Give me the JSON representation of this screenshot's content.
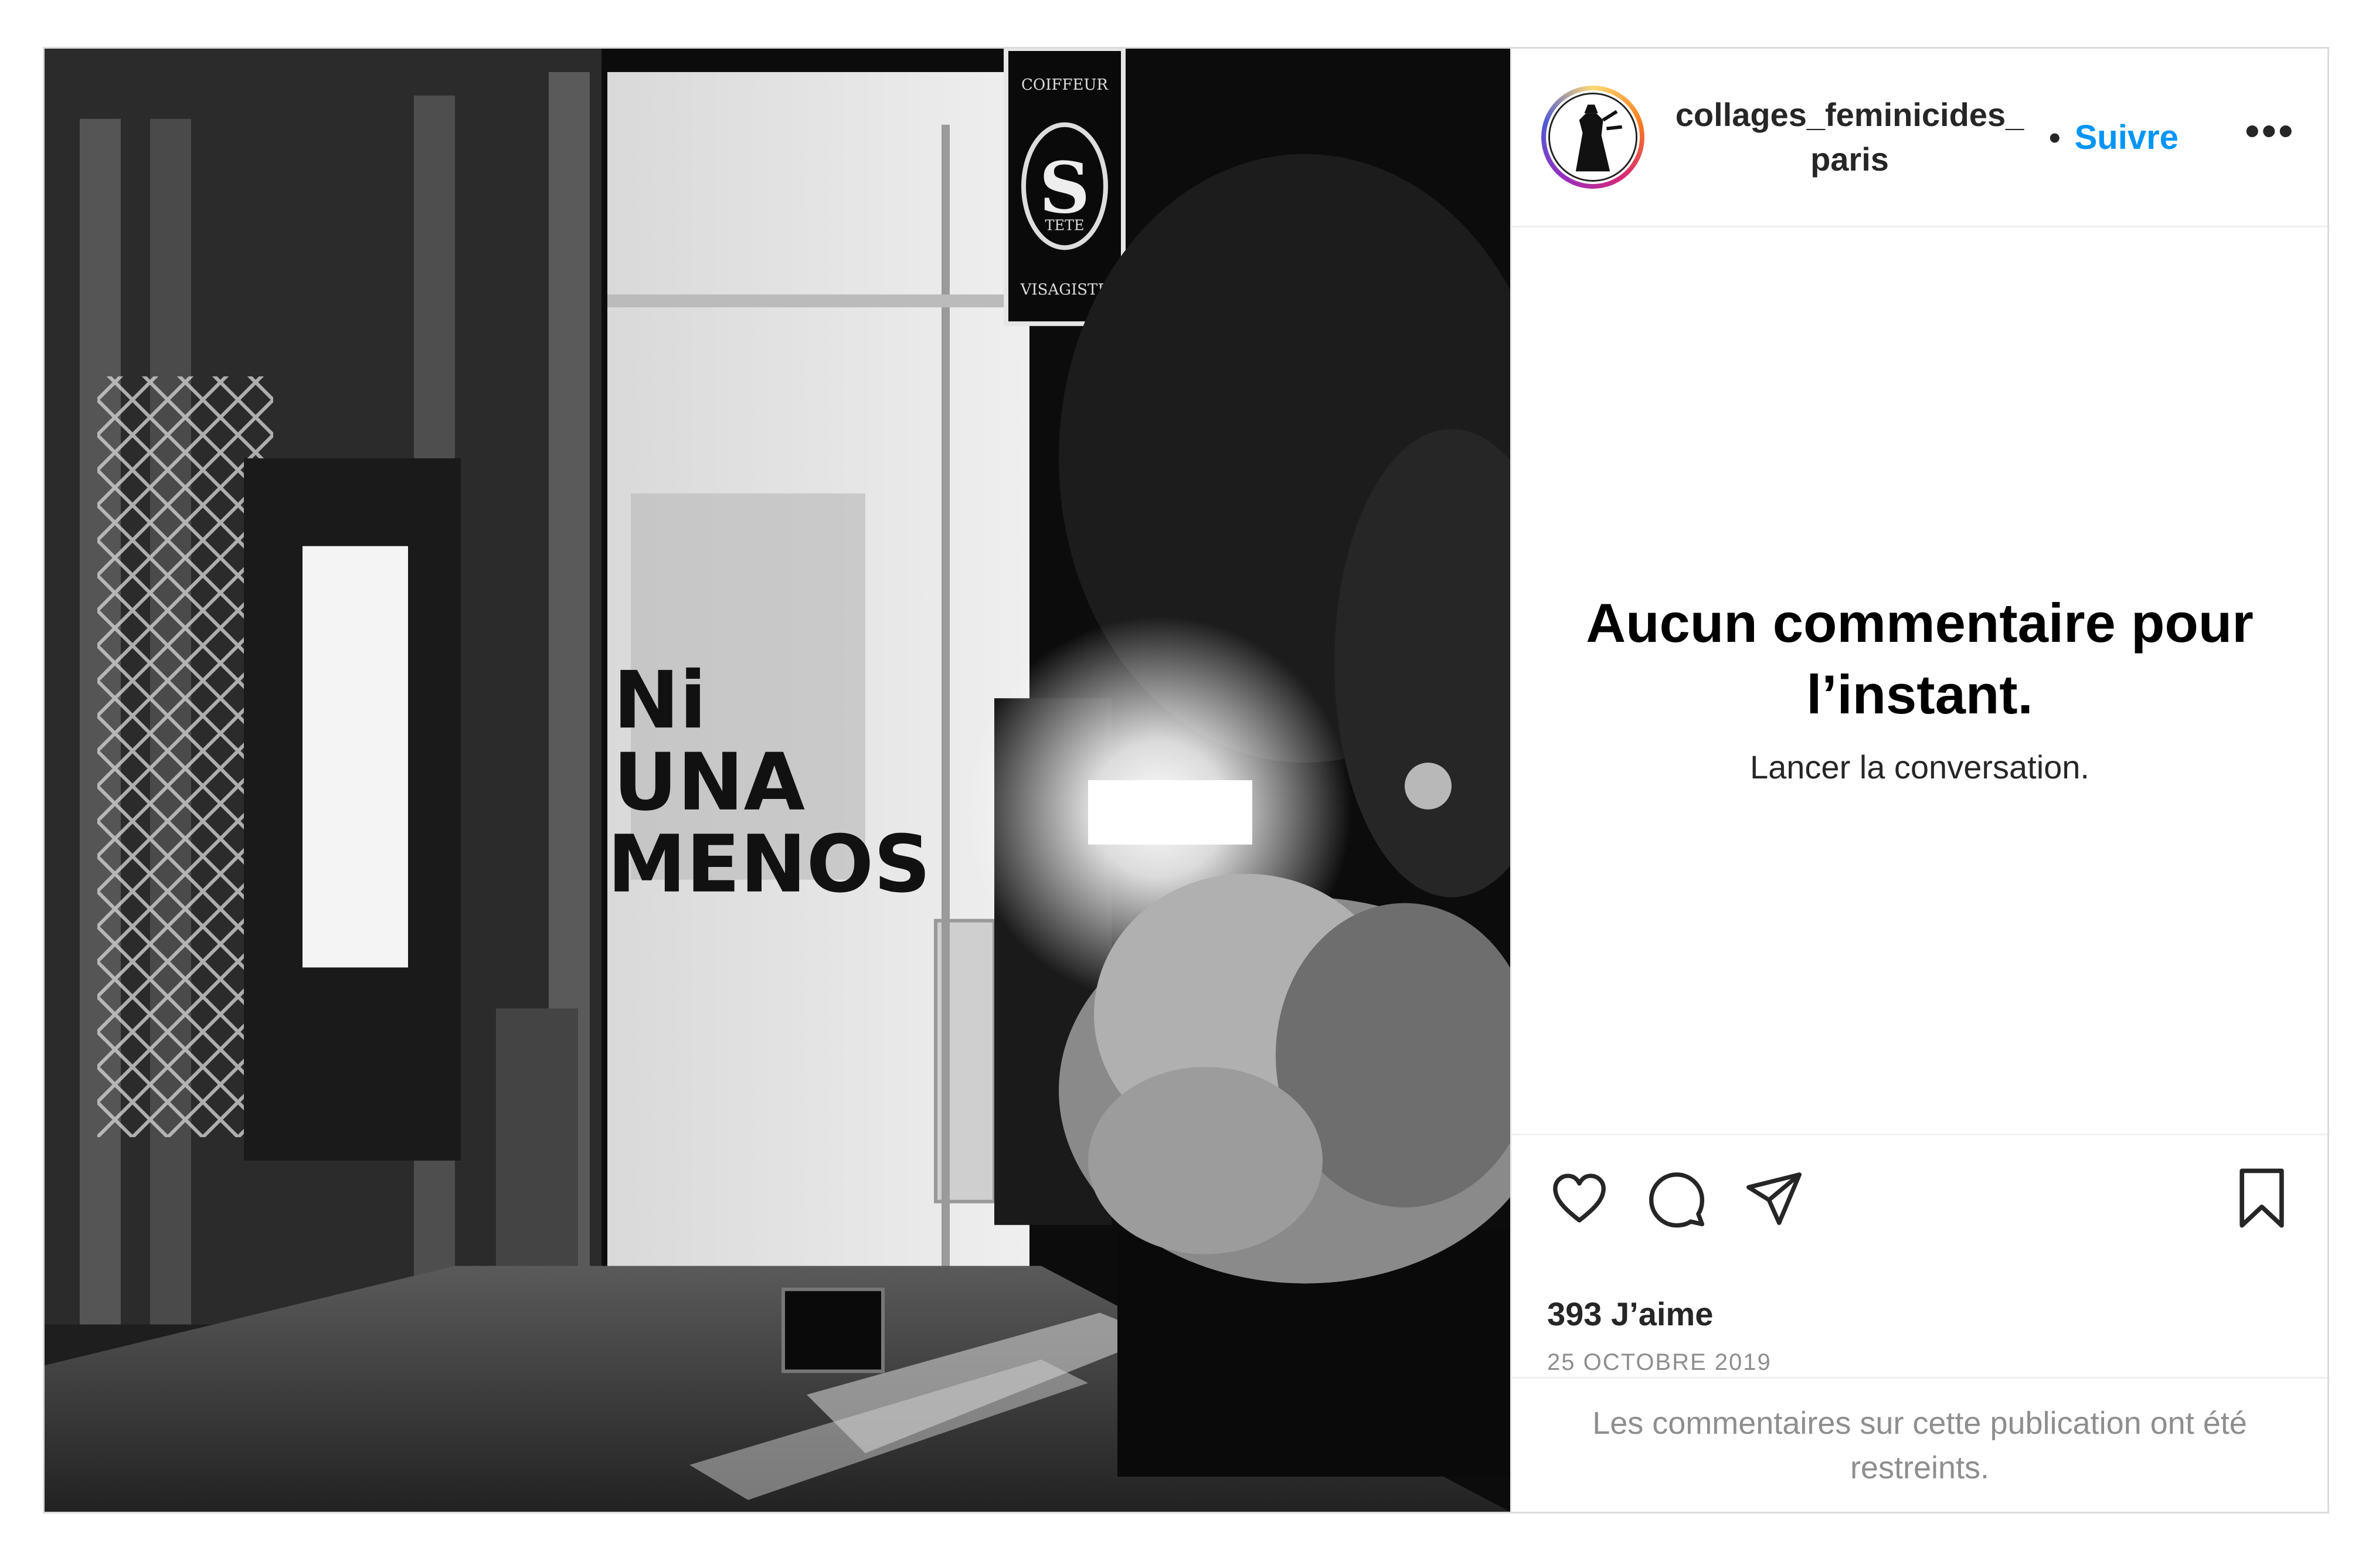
{
  "post": {
    "username_line1": "collages_feminicides_",
    "username_line2": "paris",
    "separator": "•",
    "follow_label": "Suivre",
    "more_label": "•••"
  },
  "photo": {
    "graffiti_line1": "Ni",
    "graffiti_line2": "UNA",
    "graffiti_line3": "MENOS",
    "sign_top": "COIFFEUR",
    "sign_letter": "S",
    "sign_sub": "TETE",
    "sign_bottom": "VISAGISTE"
  },
  "comments": {
    "empty_title": "Aucun commentaire pour l’instant.",
    "empty_sub": "Lancer la conversation."
  },
  "actions": {
    "icons": [
      "heart-icon",
      "comment-icon",
      "share-icon",
      "bookmark-icon"
    ],
    "likes": "393 J’aime",
    "date": "25 OCTOBRE 2019"
  },
  "footer": {
    "restricted_text": "Les commentaires sur cette publication ont été restreints."
  },
  "colors": {
    "follow": "#0095f6",
    "text": "#262626",
    "muted": "#8e8e8e",
    "border": "#dbdbdb"
  }
}
